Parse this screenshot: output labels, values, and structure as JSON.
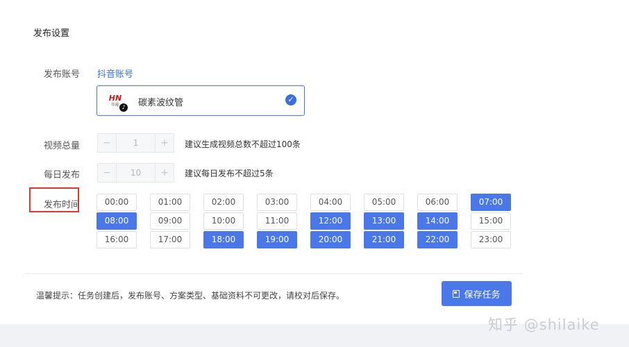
{
  "section_title": "发布设置",
  "account": {
    "label": "发布账号",
    "platform_link": "抖音账号",
    "selected_name": "碳素波纹管",
    "avatar_text": "HN",
    "avatar_sub": "华能"
  },
  "video_total": {
    "label": "视频总量",
    "value": "1",
    "minus": "−",
    "plus": "+",
    "hint": "建议生成视频总数不超过100条"
  },
  "daily_publish": {
    "label": "每日发布",
    "value": "10",
    "minus": "−",
    "plus": "+",
    "hint": "建议每日发布不超过5条"
  },
  "publish_time": {
    "label": "发布时间",
    "slots": [
      {
        "time": "00:00",
        "selected": false
      },
      {
        "time": "01:00",
        "selected": false
      },
      {
        "time": "02:00",
        "selected": false
      },
      {
        "time": "03:00",
        "selected": false
      },
      {
        "time": "04:00",
        "selected": false
      },
      {
        "time": "05:00",
        "selected": false
      },
      {
        "time": "06:00",
        "selected": false
      },
      {
        "time": "07:00",
        "selected": true
      },
      {
        "time": "08:00",
        "selected": true
      },
      {
        "time": "09:00",
        "selected": false
      },
      {
        "time": "10:00",
        "selected": false
      },
      {
        "time": "11:00",
        "selected": false
      },
      {
        "time": "12:00",
        "selected": true
      },
      {
        "time": "13:00",
        "selected": true
      },
      {
        "time": "14:00",
        "selected": true
      },
      {
        "time": "15:00",
        "selected": false
      },
      {
        "time": "16:00",
        "selected": false
      },
      {
        "time": "17:00",
        "selected": false
      },
      {
        "time": "18:00",
        "selected": true
      },
      {
        "time": "19:00",
        "selected": true
      },
      {
        "time": "20:00",
        "selected": true
      },
      {
        "time": "21:00",
        "selected": true
      },
      {
        "time": "22:00",
        "selected": true
      },
      {
        "time": "23:00",
        "selected": false
      }
    ]
  },
  "footer": {
    "tip": "温馨提示：任务创建后，发布账号、方案类型、基础资料不可更改，请校对后保存。",
    "save_label": "保存任务"
  },
  "watermark": "知乎 @shilaike",
  "colors": {
    "accent": "#4a78e8",
    "highlight_border": "#d83a3a"
  }
}
